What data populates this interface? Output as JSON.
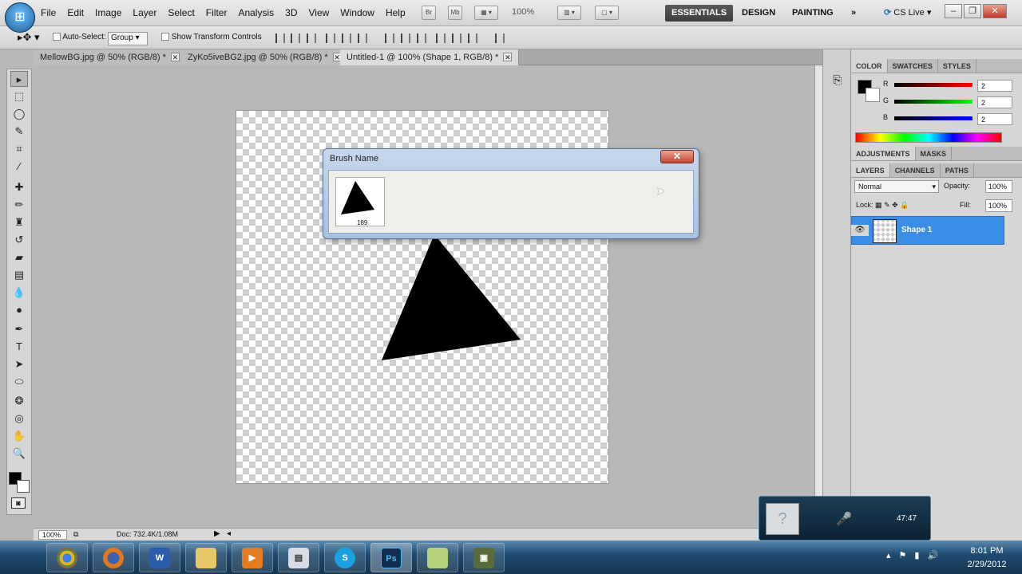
{
  "app": {
    "logo": "Ps",
    "zoom": "100%",
    "cs_live": "CS Live"
  },
  "menu": [
    "File",
    "Edit",
    "Image",
    "Layer",
    "Select",
    "Filter",
    "Analysis",
    "3D",
    "View",
    "Window",
    "Help"
  ],
  "mini_buttons": [
    "Br",
    "Mb"
  ],
  "workspaces": [
    "ESSENTIALS",
    "DESIGN",
    "PAINTING"
  ],
  "options": {
    "auto_select": "Auto-Select:",
    "group": "Group",
    "show_transform": "Show Transform Controls"
  },
  "tabs": [
    {
      "label": "MellowBG.jpg @ 50% (RGB/8) *"
    },
    {
      "label": "ZyKo5iveBG2.jpg @ 50% (RGB/8) *"
    },
    {
      "label": "Untitled-1 @ 100% (Shape 1, RGB/8) *"
    }
  ],
  "status": {
    "zoom": "100%",
    "doc": "Doc: 732.4K/1.08M"
  },
  "color_panel": {
    "tabs": [
      "COLOR",
      "SWATCHES",
      "STYLES"
    ],
    "r_label": "R",
    "g_label": "G",
    "b_label": "B",
    "r": "2",
    "g": "2",
    "b": "2"
  },
  "adjust_panel": {
    "tabs": [
      "ADJUSTMENTS",
      "MASKS"
    ]
  },
  "layers_panel": {
    "tabs": [
      "LAYERS",
      "CHANNELS",
      "PATHS"
    ],
    "blend_mode": "Normal",
    "opacity_label": "Opacity:",
    "opacity": "100%",
    "lock_label": "Lock:",
    "fill_label": "Fill:",
    "fill": "100%",
    "layer_name": "Shape 1"
  },
  "dialog": {
    "title": "Brush Name",
    "brush_size": "189"
  },
  "popup": {
    "time": "47:47"
  },
  "clock": {
    "time": "8:01 PM",
    "date": "2/29/2012"
  },
  "colors": {
    "accent": "#3a8ee6",
    "workspace_active": "#4a4a4a"
  }
}
